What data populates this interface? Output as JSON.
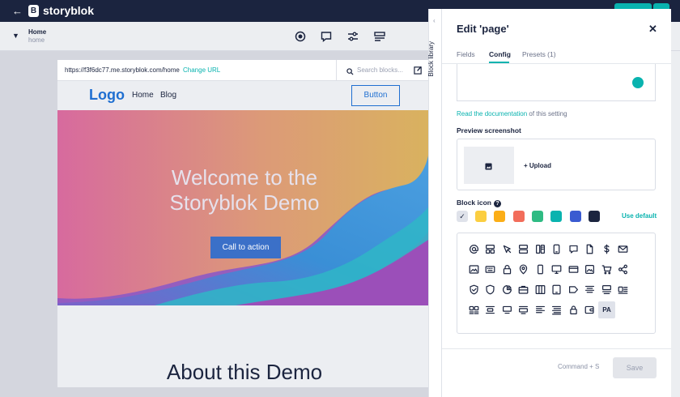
{
  "topbar": {
    "brand": "storyblok",
    "logo_letter": "B"
  },
  "story": {
    "name": "Home",
    "slug": "home"
  },
  "preview": {
    "url": "https://f3f6dc77.me.storyblok.com/home",
    "change_url": "Change URL",
    "search_placeholder": "Search blocks...",
    "site": {
      "logo": "Logo",
      "nav_home": "Home",
      "nav_blog": "Blog",
      "button": "Button",
      "hero_title_line1": "Welcome to the",
      "hero_title_line2": "Storyblok Demo",
      "cta": "Call to action",
      "about_title": "About this Demo"
    }
  },
  "block_library": {
    "label": "Block library"
  },
  "panel": {
    "title": "Edit 'page'",
    "tabs": [
      "Fields",
      "Config",
      "Presets (1)"
    ],
    "active_tab": "Config",
    "doc_link": "Read the documentation",
    "doc_suffix": " of this setting",
    "preview_screenshot_label": "Preview screenshot",
    "upload_label": "+ Upload",
    "block_icon_label": "Block icon",
    "block_icon_help": "?",
    "use_default": "Use default",
    "swatches": [
      "#dfe2ea",
      "#fbce41",
      "#fbae17",
      "#f26d5b",
      "#2fbb83",
      "#09b3af",
      "#3a5bd1",
      "#1b243f"
    ],
    "icons": [
      [
        "at-icon",
        "grid-blocks-icon",
        "cursor-icon",
        "rows-icon",
        "columns-icon",
        "phone-icon",
        "chat-icon",
        "document-icon",
        "dollar-icon",
        "mail-icon"
      ],
      [
        "image-icon",
        "keyboard-icon",
        "lock-icon",
        "pin-icon",
        "mobile-icon",
        "monitor-icon",
        "card-icon",
        "picture-icon",
        "cart-icon",
        "share-icon"
      ],
      [
        "shield-check-icon",
        "shield-icon",
        "pie-icon",
        "briefcase-icon",
        "three-columns-icon",
        "tablet-icon",
        "tag-icon",
        "align-center-icon",
        "media-text-icon",
        "media-list-icon"
      ],
      [
        "gallery-icon",
        "text-block-icon",
        "hero-icon",
        "hero-bottom-icon",
        "align-left-icon",
        "justify-icon",
        "padlock-icon",
        "wallet-icon",
        "pa-icon"
      ]
    ],
    "pa_label": "PA",
    "shortcut": "Command + S",
    "save": "Save"
  }
}
